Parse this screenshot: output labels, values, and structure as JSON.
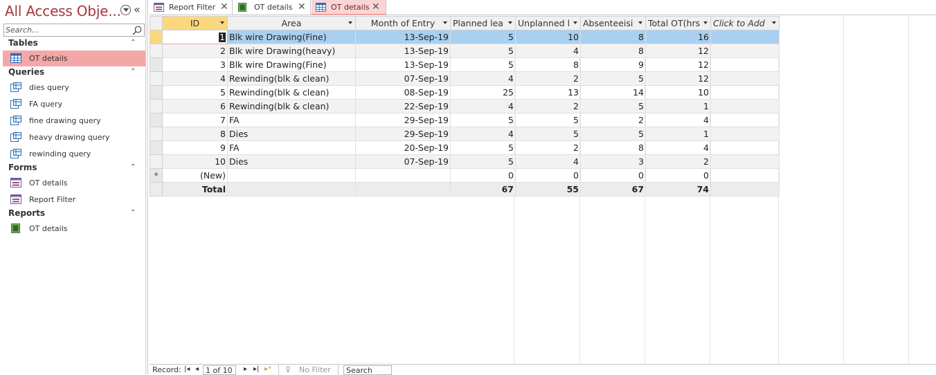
{
  "nav": {
    "title": "All Access Obje...",
    "search_placeholder": "Search...",
    "groups": [
      {
        "label": "Tables",
        "items": [
          {
            "label": "OT details",
            "icon": "table-icon",
            "selected": true
          }
        ]
      },
      {
        "label": "Queries",
        "items": [
          {
            "label": "dies query",
            "icon": "query-icon"
          },
          {
            "label": "FA query",
            "icon": "query-icon"
          },
          {
            "label": "fine drawing query",
            "icon": "query-icon"
          },
          {
            "label": "heavy drawing query",
            "icon": "query-icon"
          },
          {
            "label": "rewinding query",
            "icon": "query-icon"
          }
        ]
      },
      {
        "label": "Forms",
        "items": [
          {
            "label": "OT details",
            "icon": "form-icon"
          },
          {
            "label": "Report Filter",
            "icon": "form-icon"
          }
        ]
      },
      {
        "label": "Reports",
        "items": [
          {
            "label": "OT details",
            "icon": "report-icon"
          }
        ]
      }
    ]
  },
  "tabs": [
    {
      "label": "Report Filter",
      "icon": "form-icon",
      "active": false
    },
    {
      "label": "OT details",
      "icon": "report-icon",
      "active": false
    },
    {
      "label": "OT details",
      "icon": "table-icon",
      "active": true
    }
  ],
  "sheet": {
    "columns": [
      "ID",
      "Area",
      "Month of Entry",
      "Planned lea",
      "Unplanned l",
      "Absenteeisi",
      "Total OT(hrs",
      "Click to Add"
    ],
    "rows": [
      [
        "1",
        "Blk wire Drawing(Fine)",
        "13-Sep-19",
        "5",
        "10",
        "8",
        "16"
      ],
      [
        "2",
        "Blk wire Drawing(heavy)",
        "13-Sep-19",
        "5",
        "4",
        "8",
        "12"
      ],
      [
        "3",
        "Blk wire Drawing(Fine)",
        "13-Sep-19",
        "5",
        "8",
        "9",
        "12"
      ],
      [
        "4",
        "Rewinding(blk & clean)",
        "07-Sep-19",
        "4",
        "2",
        "5",
        "12"
      ],
      [
        "5",
        "Rewinding(blk & clean)",
        "08-Sep-19",
        "25",
        "13",
        "14",
        "10"
      ],
      [
        "6",
        "Rewinding(blk & clean)",
        "22-Sep-19",
        "4",
        "2",
        "5",
        "1"
      ],
      [
        "7",
        "FA",
        "29-Sep-19",
        "5",
        "5",
        "2",
        "4"
      ],
      [
        "8",
        "Dies",
        "29-Sep-19",
        "4",
        "5",
        "5",
        "1"
      ],
      [
        "9",
        "FA",
        "20-Sep-19",
        "5",
        "2",
        "8",
        "4"
      ],
      [
        "10",
        "Dies",
        "07-Sep-19",
        "5",
        "4",
        "3",
        "2"
      ]
    ],
    "new_row": {
      "marker": "*",
      "id": "(New)",
      "values": [
        "0",
        "0",
        "0",
        "0"
      ]
    },
    "total_row": {
      "label": "Total",
      "values": [
        "67",
        "55",
        "67",
        "74"
      ]
    }
  },
  "recbar": {
    "label": "Record:",
    "position": "1 of 10",
    "filter": "No Filter",
    "search": "Search"
  },
  "colors": {
    "title": "#a4373a",
    "selected_nav": "#f4a7a7",
    "selected_row": "#a9d0f0",
    "header_selected": "#fbd87d"
  }
}
